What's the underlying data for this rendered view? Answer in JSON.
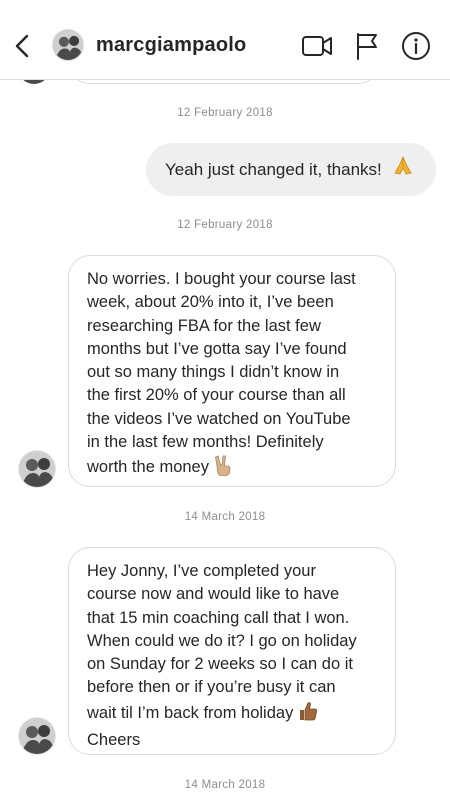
{
  "header": {
    "username": "marcgiampaolo"
  },
  "icons": {
    "back": "chevron-left-icon",
    "video": "video-camera-icon",
    "flag": "flag-icon",
    "info": "info-icon"
  },
  "messages": [
    {
      "type": "timestamp",
      "text": "12 February 2018"
    },
    {
      "type": "outgoing",
      "text": "Yeah just changed it, thanks!",
      "emoji": "folded-hands"
    },
    {
      "type": "timestamp",
      "text": "12 February 2018"
    },
    {
      "type": "incoming",
      "lines": [
        "No worries. I bought your course last",
        "week, about 20% into it, I’ve been",
        "researching FBA for the last few",
        "months but I’ve gotta say I’ve found",
        "out so many things I didn’t know in",
        "the first 20% of your course than all",
        "the videos I’ve watched on YouTube",
        "in the last few months! Definitely",
        "worth the money"
      ],
      "emoji": "victory-hand"
    },
    {
      "type": "timestamp",
      "text": "14 March 2018"
    },
    {
      "type": "incoming",
      "lines": [
        "Hey Jonny, I’ve completed your",
        "course now and would like to have",
        "that 15 min coaching call that I won.",
        "When could we do it? I go on holiday",
        "on Sunday for 2 weeks so I can do it",
        "before then or if you’re busy it can",
        "wait til I’m back from holiday",
        "Cheers"
      ],
      "emoji": "thumbs-up"
    },
    {
      "type": "timestamp",
      "text": "14 March 2018"
    }
  ],
  "colors": {
    "outgoing_bubble": "#efefef",
    "bubble_border": "#dbdbdb",
    "timestamp": "#8e8e8e",
    "text": "#262626"
  }
}
